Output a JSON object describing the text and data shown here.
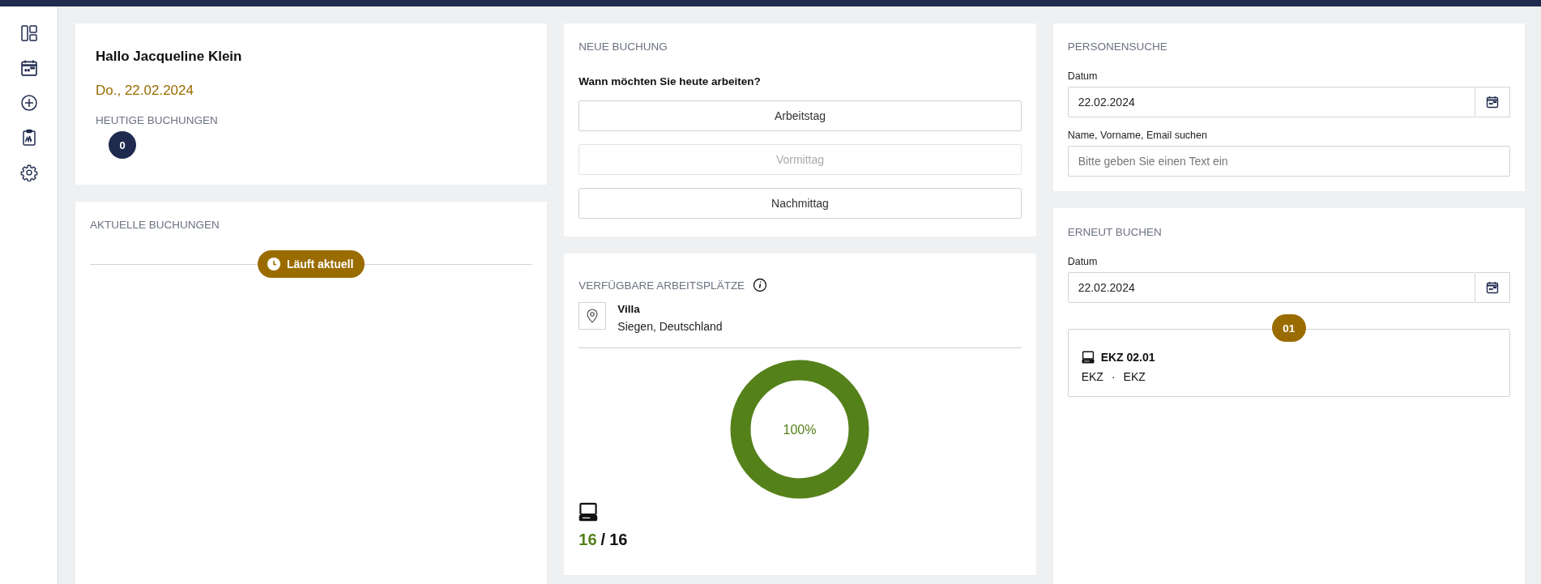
{
  "welcome": {
    "greeting": "Hallo Jacqueline Klein",
    "date": "Do., 22.02.2024",
    "bookings_label": "HEUTIGE BUCHUNGEN",
    "bookings_count": "0"
  },
  "current_bookings": {
    "title": "AKTUELLE BUCHUNGEN",
    "status": "Läuft aktuell"
  },
  "new_booking": {
    "title": "NEUE BUCHUNG",
    "question": "Wann möchten Sie heute arbeiten?",
    "options": [
      {
        "label": "Arbeitstag",
        "disabled": false
      },
      {
        "label": "Vormittag",
        "disabled": true
      },
      {
        "label": "Nachmittag",
        "disabled": false
      }
    ]
  },
  "available": {
    "title": "VERFÜGBARE ARBEITSPLÄTZE",
    "location": {
      "name": "Villa",
      "address": "Siegen, Deutschland"
    },
    "level": 1,
    "percent": "100%",
    "free": "16",
    "separator": "/",
    "total": "16"
  },
  "person_search": {
    "title": "PERSONENSUCHE",
    "date_label": "Datum",
    "date_value": "22.02.2024",
    "search_label": "Name, Vorname, Email suchen",
    "search_placeholder": "Bitte geben Sie einen Text ein"
  },
  "rebook": {
    "title": "ERNEUT BUCHEN",
    "date_label": "Datum",
    "date_value": "22.02.2024",
    "results": [
      {
        "index": "01",
        "name": "EKZ 02.01",
        "details": [
          "EKZ",
          "EKZ"
        ],
        "separator": "·"
      }
    ]
  }
}
